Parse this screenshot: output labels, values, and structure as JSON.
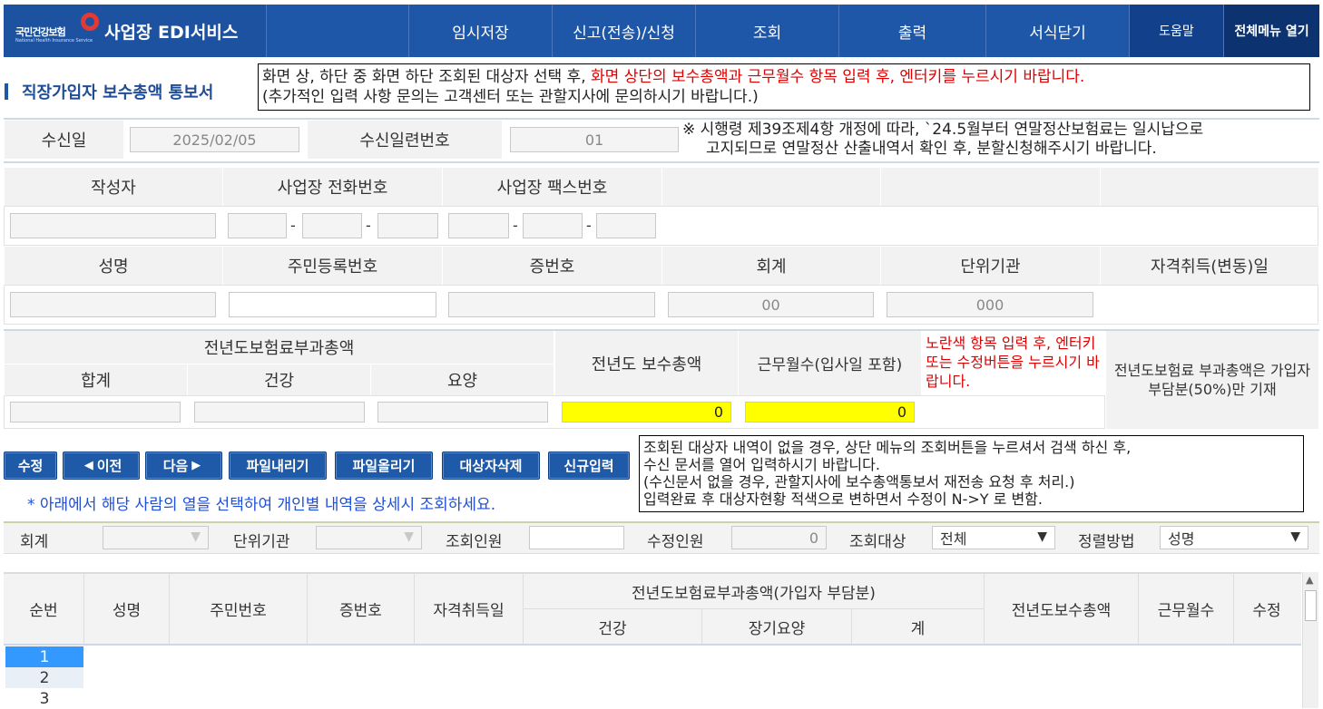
{
  "brand": {
    "org": "국민건강보험",
    "sub": "National Health Insurance Service",
    "title": "사업장 EDI서비스"
  },
  "nav": {
    "items": [
      "임시저장",
      "신고(전송)/신청",
      "조회",
      "출력",
      "서식닫기"
    ],
    "help": "도움말",
    "all_menu": "전체메뉴 열기"
  },
  "page_title": "직장가입자 보수총액 통보서",
  "notice_top": {
    "line1_black": "화면 상, 하단 중 화면 하단 조회된 대상자 선택 후, ",
    "line1_red": "화면 상단의 보수총액과 근무월수 항목 입력 후, 엔터키를 누르시기 바랍니다.",
    "line2": "(추가적인 입력 사항 문의는 고객센터 또는 관할지사에 문의하시기 바랍니다.)"
  },
  "receipt": {
    "date_label": "수신일",
    "date_value": "2025/02/05",
    "serial_label": "수신일련번호",
    "serial_value": "01",
    "notice_line1": "※ 시행령 제39조제4항 개정에 따라, `24.5월부터 연말정산보험료는 일시납으로",
    "notice_line2": "고지되므로 연말정산 산출내역서 확인 후, 분할신청해주시기 바랍니다."
  },
  "writer": {
    "writer_label": "작성자",
    "phone_label": "사업장 전화번호",
    "fax_label": "사업장 팩스번호",
    "dash": "-"
  },
  "person": {
    "name_label": "성명",
    "rrn_label": "주민등록번호",
    "cert_label": "증번호",
    "account_label": "회계",
    "account_value": "00",
    "unit_label": "단위기관",
    "unit_value": "000",
    "qualify_label": "자격취득(변동)일"
  },
  "premium": {
    "group_label": "전년도보험료부과총액",
    "sum_label": "합계",
    "health_label": "건강",
    "care_label": "요양",
    "total_pay_label": "전년도 보수총액",
    "total_pay_value": "0",
    "months_label": "근무월수(입사일 포함)",
    "months_value": "0",
    "yellow_note": "노란색 항목 입력 후, 엔터키 또는 수정버튼을 누르시기 바랍니다.",
    "note": "전년도보험료 부과총액은 가입자부담분(50%)만 기재"
  },
  "buttons": {
    "edit": "수정",
    "prev": "이전",
    "next": "다음",
    "download": "파일내리기",
    "upload": "파일올리기",
    "delete": "대상자삭제",
    "new": "신규입력"
  },
  "hint": "* 아래에서 해당 사람의 열을 선택하여 개인별 내역을 상세시 조회하세요.",
  "notice_mid": {
    "line1": "조회된 대상자 내역이 없을 경우, 상단 메뉴의 조회버튼을 누르셔서 검색 하신 후,",
    "line2": "수신 문서를 열어 입력하시기 바랍니다.",
    "line3": "(수신문서 없을 경우, 관할지사에 보수총액통보서 재전송 요청 후 처리.)",
    "line4": "입력완료 후 대상자현황 적색으로 변하면서 수정이 N->Y 로 변함."
  },
  "filter": {
    "account_label": "회계",
    "unit_label": "단위기관",
    "count_label": "조회인원",
    "edited_label": "수정인원",
    "edited_value": "0",
    "target_label": "조회대상",
    "target_value": "전체",
    "sort_label": "정렬방법",
    "sort_value": "성명"
  },
  "grid": {
    "cols": {
      "seq": "순번",
      "name": "성명",
      "rrn": "주민번호",
      "cert": "증번호",
      "qualify": "자격취득일",
      "premium_group": "전년도보험료부과총액(가입자 부담분)",
      "health": "건강",
      "ltc": "장기요양",
      "total": "계",
      "pay_total": "전년도보수총액",
      "months": "근무월수",
      "edited": "수정"
    },
    "rows": [
      "1",
      "2",
      "3"
    ]
  }
}
